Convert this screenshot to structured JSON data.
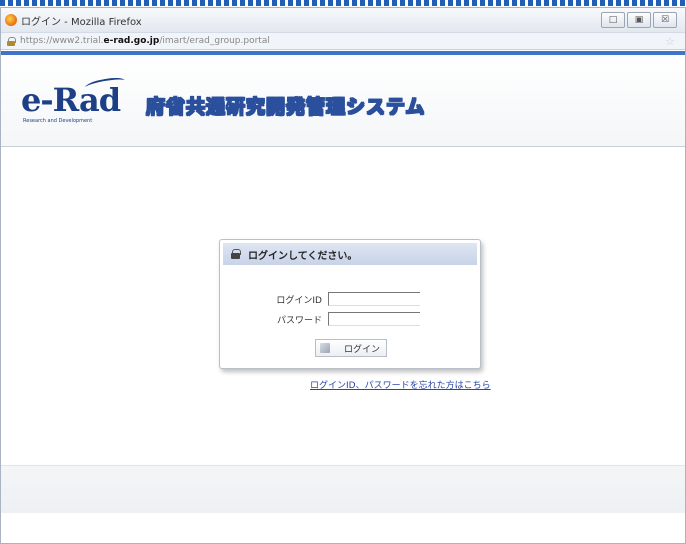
{
  "window": {
    "title": "ログイン - Mozilla Firefox",
    "controls": [
      "□",
      "▣",
      "☒"
    ]
  },
  "address_bar": {
    "url_prefix": "https://www2.trial.",
    "url_host": "e-rad.go.jp",
    "url_path": "/imart/erad_group.portal"
  },
  "header": {
    "logo_text": "e-Rad",
    "logo_subtitle": "Research and Development",
    "system_name": "府省共通研究開発管理システム"
  },
  "login": {
    "title": "ログインしてください。",
    "id_label": "ログインID",
    "password_label": "パスワード",
    "id_value": "",
    "password_value": "",
    "button_label": "ログイン",
    "forgot_link": "ログインID、パスワードを忘れた方はこちら"
  },
  "colors": {
    "brand_blue": "#1c3f86",
    "banner_stripe": "#3e74c9",
    "link": "#2946a8"
  }
}
